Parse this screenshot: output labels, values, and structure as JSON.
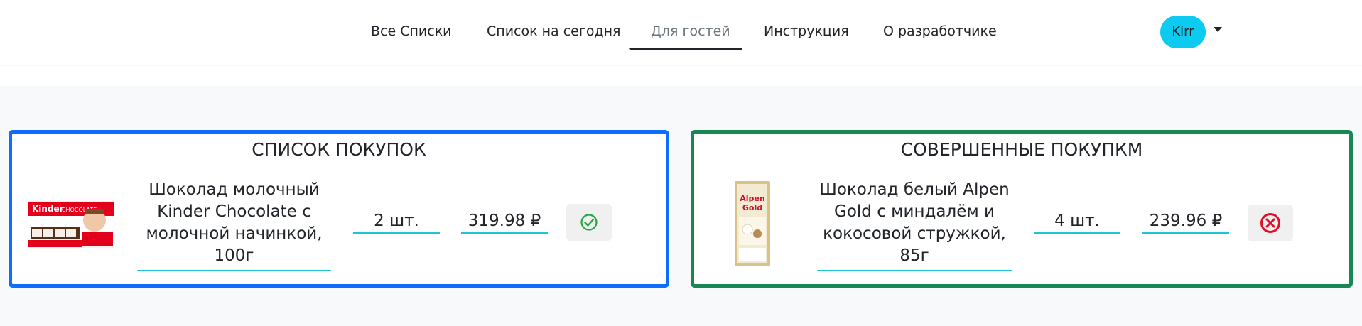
{
  "nav": {
    "items": [
      {
        "label": "Все Списки"
      },
      {
        "label": "Список на сегодня"
      },
      {
        "label": "Для гостей"
      },
      {
        "label": "Инструкция"
      },
      {
        "label": "О разработчике"
      }
    ],
    "active_index": 2,
    "user": {
      "name": "Kirr"
    }
  },
  "panels": {
    "shopping": {
      "title": "СПИСОК ПОКУПОК",
      "border_color": "#0d6efd",
      "items": [
        {
          "name": "Шоколад молочный Kinder Chocolate с молочной начинкой, 100г",
          "qty": "2 шт.",
          "price": "319.98 ₽",
          "image": "kinder-chocolate-product-image",
          "action": "check-circle-icon"
        }
      ]
    },
    "completed": {
      "title": "СОВЕРШЕННЫЕ ПОКУПКМ",
      "border_color": "#198754",
      "items": [
        {
          "name": "Шоколад белый Alpen Gold с миндалём и кокосовой стружкой, 85г",
          "qty": "4 шт.",
          "price": "239.96 ₽",
          "image": "alpen-gold-product-image",
          "action": "x-circle-icon"
        }
      ]
    }
  },
  "colors": {
    "accent": "#0dcaf0",
    "success": "#198754",
    "primary": "#0d6efd",
    "danger": "#dc3545",
    "check_green": "#28a745"
  }
}
